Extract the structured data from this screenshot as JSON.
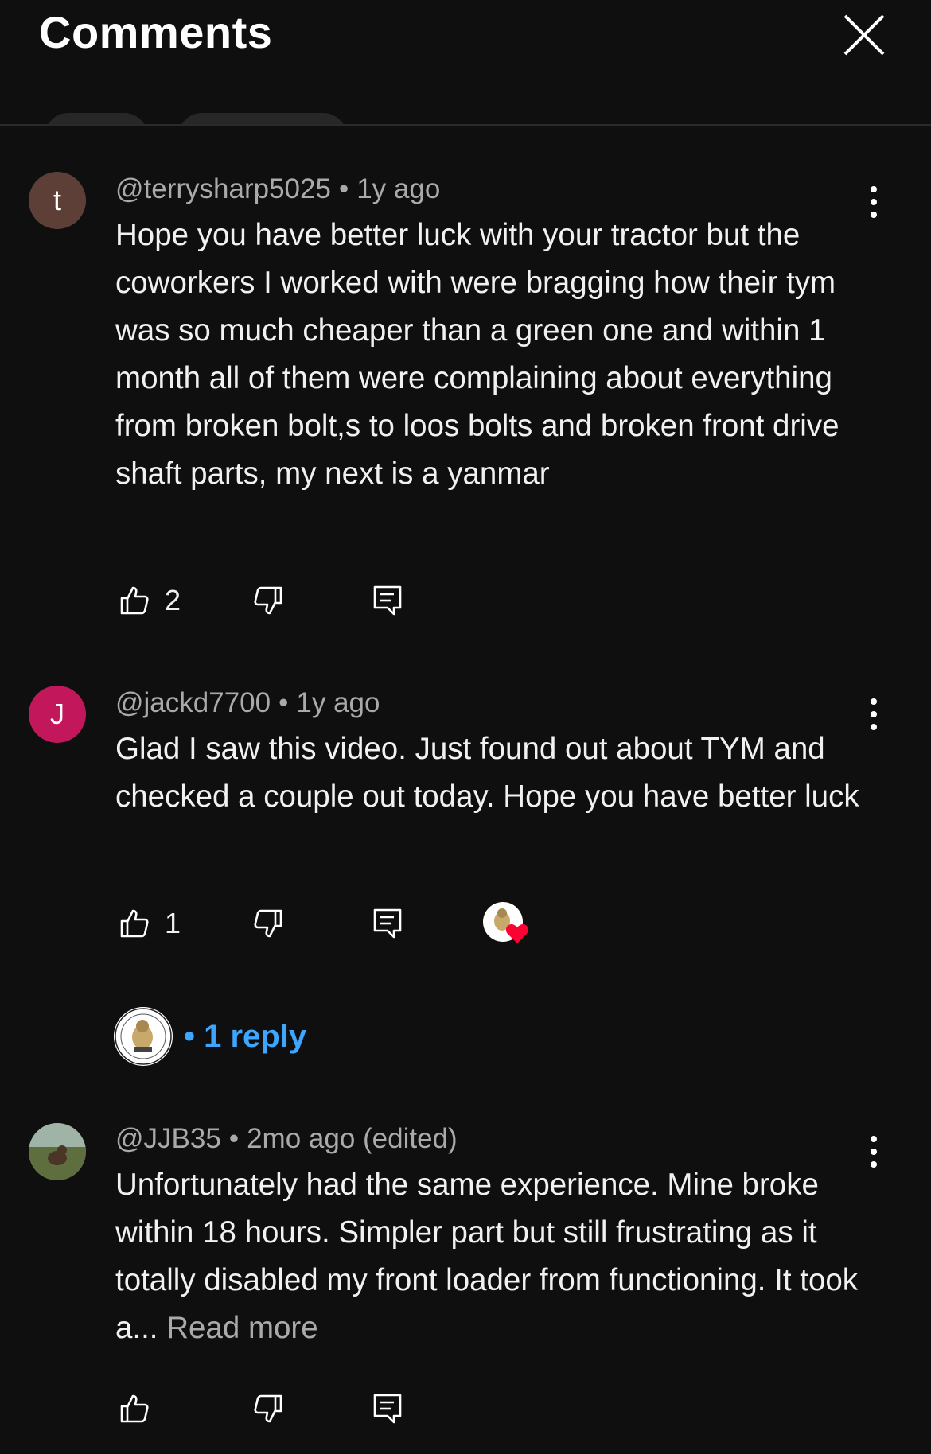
{
  "header": {
    "title": "Comments",
    "close_icon": "close-icon"
  },
  "comments": [
    {
      "avatar_letter": "t",
      "avatar_color": "#5d3f38",
      "author": "@terrysharp5025",
      "time": "1y ago",
      "text": "Hope you have better luck with your tractor but the coworkers I worked with were bragging how their tym  was so much cheaper than a green one and within 1 month all of them were complaining about everything from broken bolt,s to loos bolts and broken front drive shaft parts, my next is a yanmar",
      "likes": "2"
    },
    {
      "avatar_letter": "J",
      "avatar_color": "#c2185b",
      "author": "@jackd7700",
      "time": "1y ago",
      "text": "Glad I saw this video. Just found out about TYM and checked a couple out today. Hope you have better luck",
      "likes": "1",
      "creator_heart": true,
      "replies_label": "1 reply"
    },
    {
      "avatar_letter": "",
      "avatar_color": "#5a6b4a",
      "author": "@JJB35",
      "time": "2mo ago (edited)",
      "text": "Unfortunately had the same experience.  Mine broke within 18 hours.   Simpler part but still frustrating as it totally disabled my front loader from functioning. It took a...",
      "read_more": "Read more",
      "likes": ""
    }
  ],
  "colors": {
    "background": "#0f0f0f",
    "reply_link": "#3ea6ff",
    "heart": "#ff0033"
  }
}
